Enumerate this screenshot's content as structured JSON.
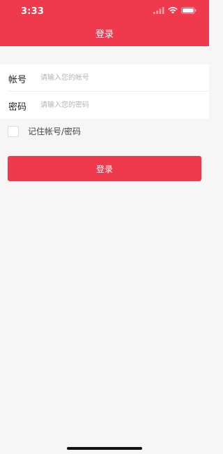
{
  "status_bar": {
    "time": "3:33",
    "icons": [
      "signal-icon",
      "wifi-icon",
      "battery-icon"
    ]
  },
  "header": {
    "title": "登录"
  },
  "form": {
    "account": {
      "label": "帐号",
      "value": "",
      "placeholder": "请输入您的帐号"
    },
    "password": {
      "label": "密码",
      "value": "",
      "placeholder": "请输入您的密码"
    }
  },
  "remember": {
    "label": "记住帐号/密码",
    "checked": false
  },
  "login_button": {
    "label": "登录"
  },
  "colors": {
    "accent": "#ee3a4c",
    "background": "#f6f6f6",
    "surface": "#ffffff",
    "placeholder": "#b4b4b4"
  }
}
